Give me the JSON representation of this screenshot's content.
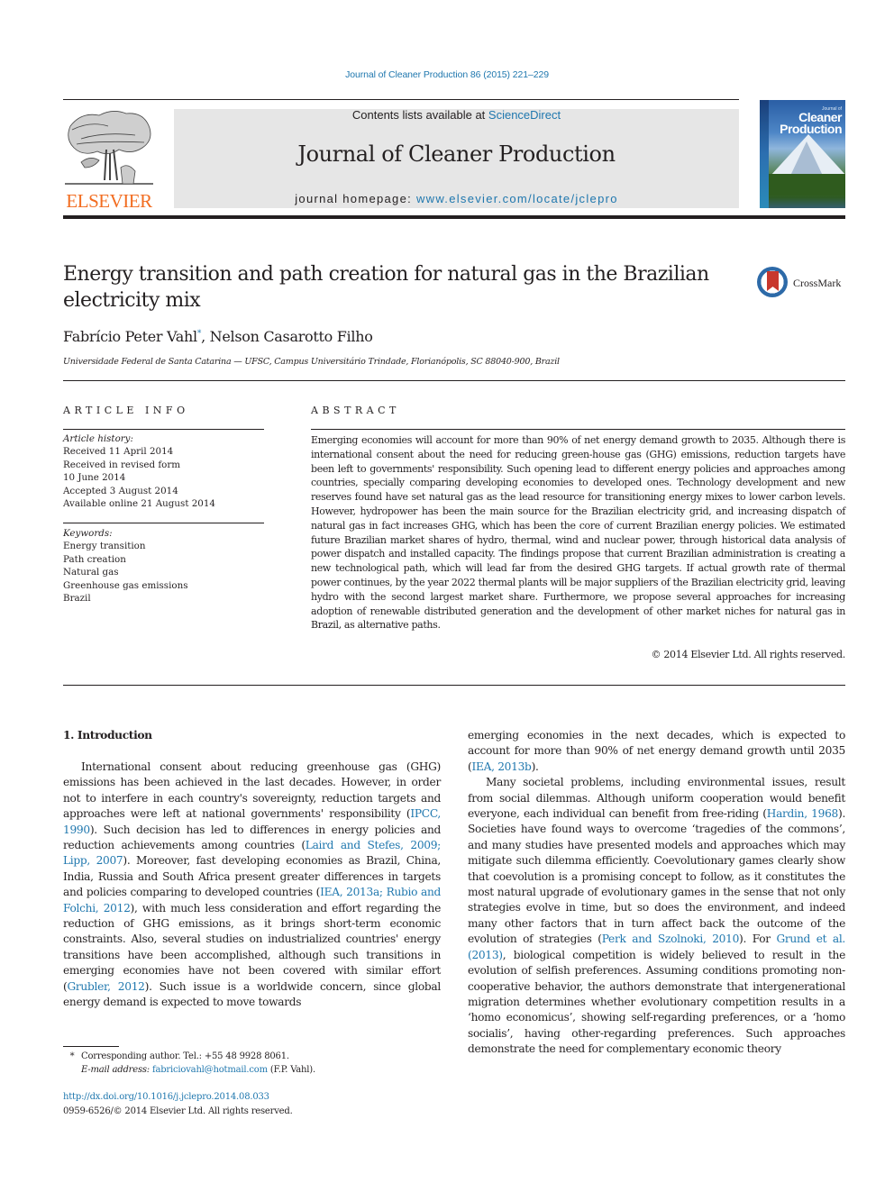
{
  "header": {
    "citation": "Journal of Cleaner Production 86 (2015) 221–229",
    "publisher_logo_text": "ELSEVIER",
    "contents_prefix": "Contents lists available at ",
    "contents_link": "ScienceDirect",
    "journal_title": "Journal of Cleaner Production",
    "homepage_prefix": "journal homepage: ",
    "homepage_link": "www.elsevier.com/locate/jclepro",
    "cover": {
      "small_text": "Journal of",
      "title_line1": "Cleaner",
      "title_line2": "Production"
    },
    "colors": {
      "link": "#1f77ae",
      "elsevier_orange": "#f26d21",
      "banner_bg": "#e6e6e6"
    }
  },
  "article": {
    "title": "Energy transition and path creation for natural gas in the Brazilian electricity mix",
    "crossmark_label": "CrossMark",
    "author1": "Fabrício Peter Vahl",
    "author1_mark": "*",
    "author_sep": ", ",
    "author2": "Nelson Casarotto Filho",
    "affiliation": "Universidade Federal de Santa Catarina — UFSC, Campus Universitário Trindade, Florianópolis, SC 88040-900, Brazil"
  },
  "article_info": {
    "heading": "ARTICLE INFO",
    "history_label": "Article history:",
    "history": [
      "Received 11 April 2014",
      "Received in revised form",
      "10 June 2014",
      "Accepted 3 August 2014",
      "Available online 21 August 2014"
    ],
    "keywords_label": "Keywords:",
    "keywords": [
      "Energy transition",
      "Path creation",
      "Natural gas",
      "Greenhouse gas emissions",
      "Brazil"
    ]
  },
  "abstract": {
    "heading": "ABSTRACT",
    "text": "Emerging economies will account for more than 90% of net energy demand growth to 2035. Although there is international consent about the need for reducing green-house gas (GHG) emissions, reduction targets have been left to governments' responsibility. Such opening lead to different energy policies and approaches among countries, specially comparing developing economies to developed ones. Technology development and new reserves found have set natural gas as the lead resource for transitioning energy mixes to lower carbon levels. However, hydropower has been the main source for the Brazilian electricity grid, and increasing dispatch of natural gas in fact increases GHG, which has been the core of current Brazilian energy policies. We estimated future Brazilian market shares of hydro, thermal, wind and nuclear power, through historical data analysis of power dispatch and installed capacity. The findings propose that current Brazilian administration is creating a new technological path, which will lead far from the desired GHG targets. If actual growth rate of thermal power continues, by the year 2022 thermal plants will be major suppliers of the Brazilian electricity grid, leaving hydro with the second largest market share. Furthermore, we propose several approaches for increasing adoption of renewable distributed generation and the development of other market niches for natural gas in Brazil, as alter­native paths.",
    "copyright": "© 2014 Elsevier Ltd. All rights reserved."
  },
  "body": {
    "section_heading": "1.  Introduction",
    "p1": [
      {
        "t": "International consent about reducing greenhouse gas (GHG) emissions has been achieved in the last decades. However, in order not to interfere in each country's sovereignty, reduction targets and approaches were left at national governments' responsibility ("
      },
      {
        "link": "IPCC, 1990"
      },
      {
        "t": "). Such decision has led to differences in energy policies and reduction achievements among countries ("
      },
      {
        "link": "Laird and Stefes, 2009; Lipp, 2007"
      },
      {
        "t": "). Moreover, fast developing economies as Brazil, China, India, Russia and South Africa present greater differences in targets and policies comparing to developed countries ("
      },
      {
        "link": "IEA, 2013a; Rubio and Folchi, 2012"
      },
      {
        "t": "), with much less consideration and effort regarding the reduction of GHG emissions, as it brings short-term economic constraints. Also, several studies on industrialized countries' energy transitions have been accomplished, although such transitions in emerging economies have not been covered with similar effort ("
      },
      {
        "link": "Grubler, 2012"
      },
      {
        "t": "). Such issue is a worldwide concern, since global energy demand is expected to move towards "
      }
    ],
    "p1_cont": [
      {
        "t": "emerging economies in the next decades, which is expected to account for more than 90% of net energy demand growth until 2035 ("
      },
      {
        "link": "IEA, 2013b"
      },
      {
        "t": ")."
      }
    ],
    "p2": [
      {
        "t": "Many societal problems, including environmental issues, result from social dilemmas. Although uniform cooperation would benefit everyone, each individual can benefit from free-riding ("
      },
      {
        "link": "Hardin, 1968"
      },
      {
        "t": "). Societies have found ways to overcome ‘tragedies of the commons’, and many studies have presented models and ap­proaches which may mitigate such dilemma efficiently. Co­evolutionary games clearly show that coevolution is a promising concept to follow, as it constitutes the most natural upgrade of evolutionary games in the sense that not only strategies evolve in time, but so does the environment, and indeed many other factors that in turn affect back the outcome of the evolution of strategies ("
      },
      {
        "link": "Perk and Szolnoki, 2010"
      },
      {
        "t": "). For "
      },
      {
        "link": "Grund et al. (2013)"
      },
      {
        "t": ", biological competition is widely believed to result in the evolution of selfish preferences. Assuming conditions promoting non-cooperative behavior, the authors demonstrate that intergenerational migra­tion determines whether evolutionary competition results in a ‘homo economicus’, showing self-regarding preferences, or a ‘homo socialis’, having other-regarding preferences. Such approaches demonstrate the need for complementary economic theory"
      }
    ]
  },
  "footnotes": {
    "star": "*",
    "corresponding": "Corresponding author. Tel.: +55 48 9928 8061.",
    "email_label": "E-mail address: ",
    "email": "fabriciovahl@hotmail.com",
    "email_suffix": " (F.P. Vahl).",
    "doi": "http://dx.doi.org/10.1016/j.jclepro.2014.08.033",
    "issn_copyright": "0959-6526/© 2014 Elsevier Ltd. All rights reserved."
  }
}
